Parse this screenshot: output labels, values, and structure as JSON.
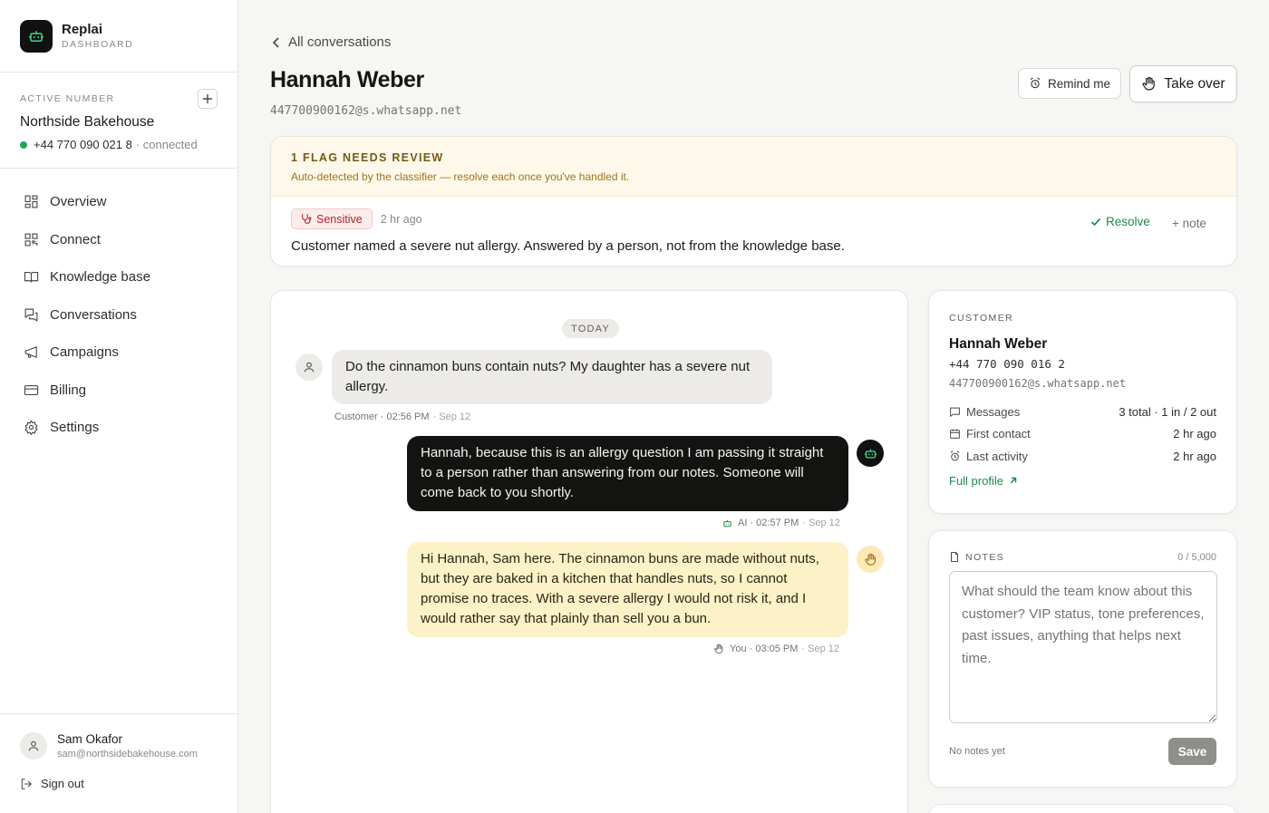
{
  "app": {
    "name": "Replai",
    "subtitle": "DASHBOARD"
  },
  "sidebar": {
    "active_number": {
      "label": "ACTIVE NUMBER",
      "business": "Northside Bakehouse",
      "phone": "+44 770 090 021 8",
      "status": "· connected"
    },
    "nav": [
      {
        "label": "Overview",
        "icon": "grid-icon"
      },
      {
        "label": "Connect",
        "icon": "qr-icon"
      },
      {
        "label": "Knowledge base",
        "icon": "book-icon"
      },
      {
        "label": "Conversations",
        "icon": "chat-icon"
      },
      {
        "label": "Campaigns",
        "icon": "megaphone-icon"
      },
      {
        "label": "Billing",
        "icon": "card-icon"
      },
      {
        "label": "Settings",
        "icon": "gear-icon"
      }
    ],
    "user": {
      "name": "Sam Okafor",
      "email": "sam@northsidebakehouse.com"
    },
    "sign_out": "Sign out"
  },
  "header": {
    "back_label": "All conversations",
    "title": "Hannah Weber",
    "jid": "447700900162@s.whatsapp.net",
    "remind_label": "Remind me",
    "takeover_label": "Take over"
  },
  "flag": {
    "title": "1 FLAG NEEDS REVIEW",
    "subtitle": "Auto-detected by the classifier — resolve each once you've handled it.",
    "badge": "Sensitive",
    "time": "2 hr ago",
    "text": "Customer named a severe nut allergy. Answered by a person, not from the knowledge base.",
    "resolve_label": "Resolve",
    "note_label": "+ note"
  },
  "chat": {
    "day_label": "TODAY",
    "messages": [
      {
        "sender": "customer",
        "text": "Do the cinnamon buns contain nuts? My daughter has a severe nut allergy.",
        "meta": "Customer · 02:56 PM",
        "date": "· Sep 12"
      },
      {
        "sender": "ai",
        "text": "Hannah, because this is an allergy question I am passing it straight to a person rather than answering from our notes. Someone will come back to you shortly.",
        "meta": "AI · 02:57 PM",
        "date": "· Sep 12"
      },
      {
        "sender": "you",
        "text": "Hi Hannah, Sam here. The cinnamon buns are made without nuts, but they are baked in a kitchen that handles nuts, so I cannot promise no traces. With a severe allergy I would not risk it, and I would rather say that plainly than sell you a bun.",
        "meta": "You · 03:05 PM",
        "date": "· Sep 12"
      }
    ]
  },
  "customer": {
    "label": "CUSTOMER",
    "name": "Hannah Weber",
    "phone": "+44 770 090 016 2",
    "jid": "447700900162@s.whatsapp.net",
    "stats": [
      {
        "key": "Messages",
        "value": "3 total · 1 in / 2 out"
      },
      {
        "key": "First contact",
        "value": "2 hr ago"
      },
      {
        "key": "Last activity",
        "value": "2 hr ago"
      }
    ],
    "full_profile": "Full profile"
  },
  "notes": {
    "label": "NOTES",
    "count": "0 / 5,000",
    "placeholder": "What should the team know about this customer? VIP status, tone preferences, past issues, anything that helps next time.",
    "empty_label": "No notes yet",
    "save_label": "Save"
  },
  "colors": {
    "accent_green": "#1f8a4c",
    "connected_dot": "#22a35c",
    "flag_bg": "#fdf8ea",
    "sensitive_red": "#b4232a",
    "ai_bubble": "#131312",
    "you_bubble": "#fcf1c7"
  }
}
